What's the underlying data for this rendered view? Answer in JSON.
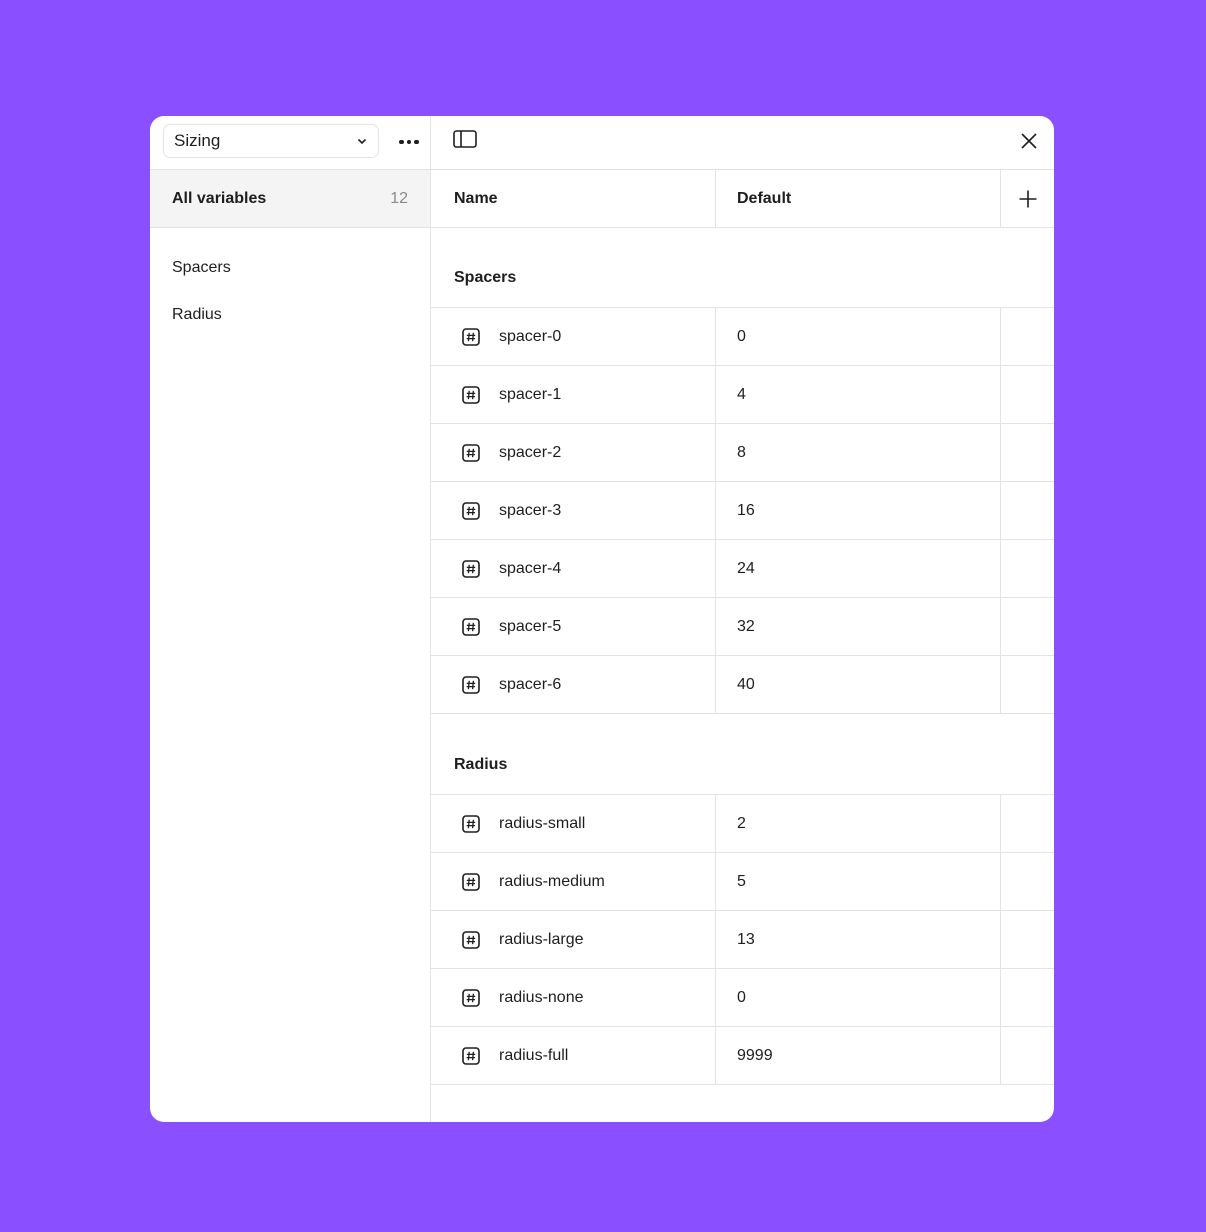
{
  "sidebar": {
    "collection_select": "Sizing",
    "all_variables": {
      "label": "All variables",
      "count": "12"
    },
    "groups": [
      "Spacers",
      "Radius"
    ]
  },
  "table": {
    "columns": {
      "name": "Name",
      "default": "Default"
    },
    "groups": [
      {
        "title": "Spacers",
        "rows": [
          {
            "name": "spacer-0",
            "value": "0"
          },
          {
            "name": "spacer-1",
            "value": "4"
          },
          {
            "name": "spacer-2",
            "value": "8"
          },
          {
            "name": "spacer-3",
            "value": "16"
          },
          {
            "name": "spacer-4",
            "value": "24"
          },
          {
            "name": "spacer-5",
            "value": "32"
          },
          {
            "name": "spacer-6",
            "value": "40"
          }
        ]
      },
      {
        "title": "Radius",
        "rows": [
          {
            "name": "radius-small",
            "value": "2"
          },
          {
            "name": "radius-medium",
            "value": "5"
          },
          {
            "name": "radius-large",
            "value": "13"
          },
          {
            "name": "radius-none",
            "value": "0"
          },
          {
            "name": "radius-full",
            "value": "9999"
          }
        ]
      }
    ]
  },
  "icons": {
    "collection_dropdown": "chevron-down-icon",
    "more_options": "more-horizontal-icon",
    "sidebar_toggle": "sidebar-toggle-icon",
    "close": "close-icon",
    "add_mode": "plus-icon",
    "variable_type": "number-variable-icon"
  },
  "colors": {
    "background": "#8a50ff",
    "panel": "#ffffff",
    "selected_row": "#f4f4f4",
    "border": "#e3e3e3"
  }
}
